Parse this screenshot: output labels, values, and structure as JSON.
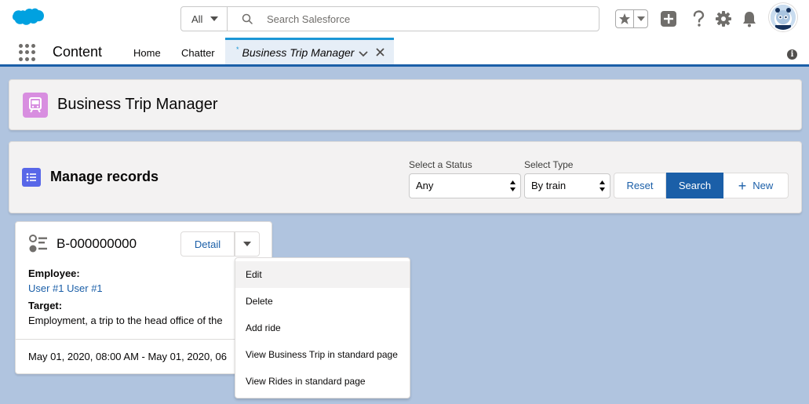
{
  "header": {
    "search_scope": "All",
    "search_placeholder": "Search Salesforce",
    "icons": [
      "salesforce-logo",
      "favorites-star-icon",
      "favorites-dropdown-icon",
      "global-add-icon",
      "help-icon",
      "setup-gear-icon",
      "notifications-bell-icon",
      "user-avatar"
    ]
  },
  "nav": {
    "app_name": "Content",
    "items": [
      {
        "label": "Home"
      },
      {
        "label": "Chatter"
      }
    ],
    "active_tab": {
      "marker": "*",
      "label": "Business Trip Manager"
    }
  },
  "page_header": {
    "title": "Business Trip Manager"
  },
  "manage": {
    "title": "Manage records",
    "status_label": "Select a Status",
    "status_value": "Any",
    "type_label": "Select Type",
    "type_value": "By train",
    "reset_label": "Reset",
    "search_label": "Search",
    "new_label": "New"
  },
  "record": {
    "title": "B-000000000",
    "detail_label": "Detail",
    "employee_label": "Employee:",
    "employee_value": "User #1 User #1",
    "target_label": "Target:",
    "target_value": "Employment, a trip to the head office of the",
    "date_range": "May 01, 2020, 08:00 AM - May 01, 2020, 06"
  },
  "menu": {
    "items": [
      {
        "label": "Edit"
      },
      {
        "label": "Delete"
      },
      {
        "label": "Add ride"
      },
      {
        "label": "View Business Trip in standard page"
      },
      {
        "label": "View Rides in standard page"
      }
    ]
  },
  "colors": {
    "brand_blue": "#1b5fa8",
    "background": "#b0c4df",
    "app_icon": "#d88ee0",
    "section_icon": "#5867e8"
  }
}
